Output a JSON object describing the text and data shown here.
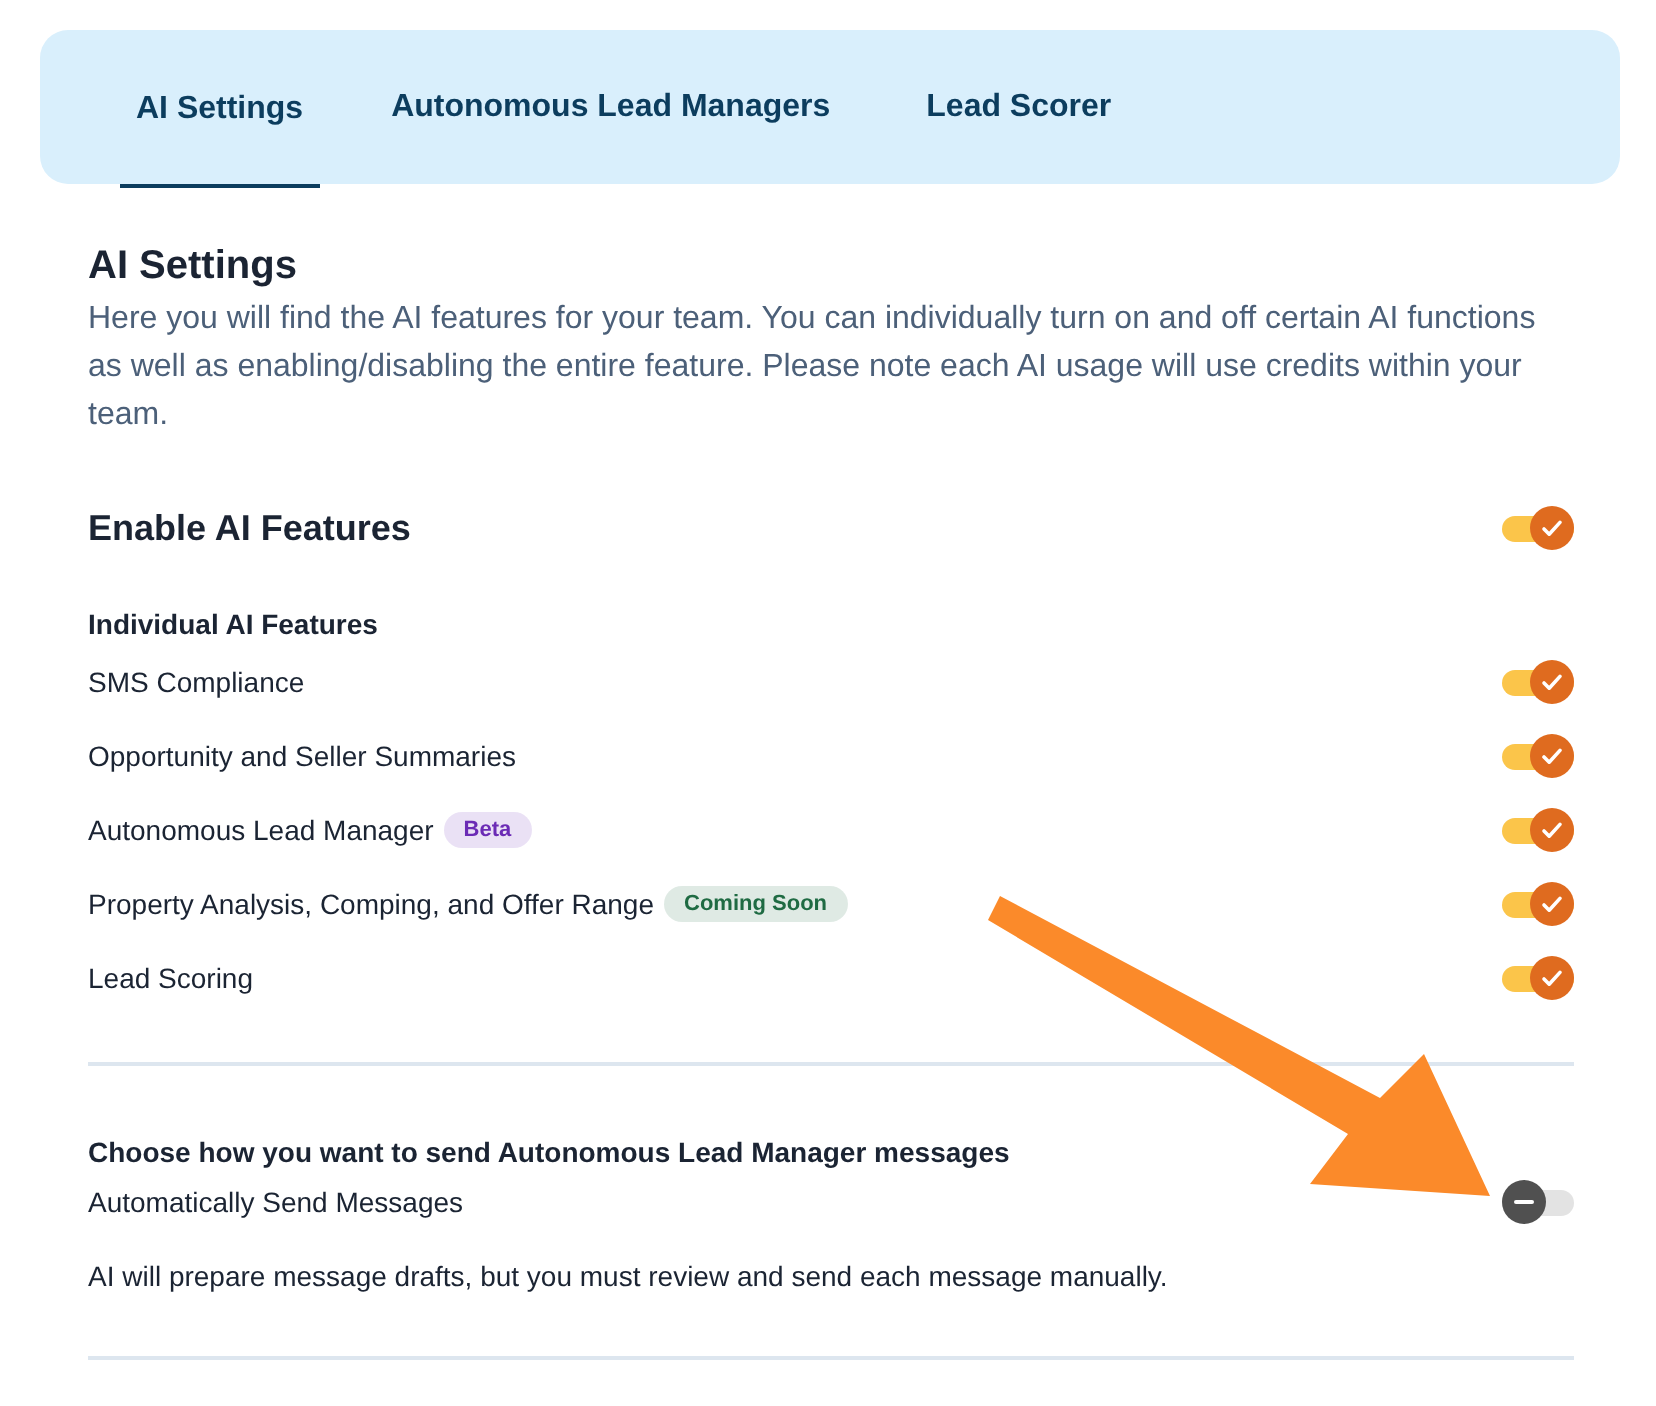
{
  "tabs": [
    {
      "label": "AI Settings",
      "selected": true
    },
    {
      "label": "Autonomous Lead Managers",
      "selected": false
    },
    {
      "label": "Lead Scorer",
      "selected": false
    }
  ],
  "intro": {
    "title": "AI Settings",
    "text": "Here you will find the AI features for your team. You can individually turn on and off certain AI functions as well as enabling/disabling the entire feature. Please note each AI usage will use credits within your team."
  },
  "master": {
    "label": "Enable AI Features",
    "on": true
  },
  "features": {
    "title": "Individual AI Features",
    "items": [
      {
        "label": "SMS Compliance",
        "on": true
      },
      {
        "label": "Opportunity and Seller Summaries",
        "on": true
      },
      {
        "label": "Autonomous Lead Manager",
        "on": true,
        "badge": {
          "label": "Beta",
          "color": "#6b2bb5"
        }
      },
      {
        "label": "Property Analysis, Comping, and Offer Range",
        "on": true,
        "badge": {
          "label": "Coming Soon",
          "color": "#1f6b43"
        }
      },
      {
        "label": "Lead Scoring",
        "on": true
      }
    ]
  },
  "sending": {
    "title": "Choose how you want to send Autonomous Lead Manager messages",
    "label": "Automatically Send Messages",
    "on": false,
    "description": "AI will prepare message drafts, but you must review and send each message manually."
  }
}
